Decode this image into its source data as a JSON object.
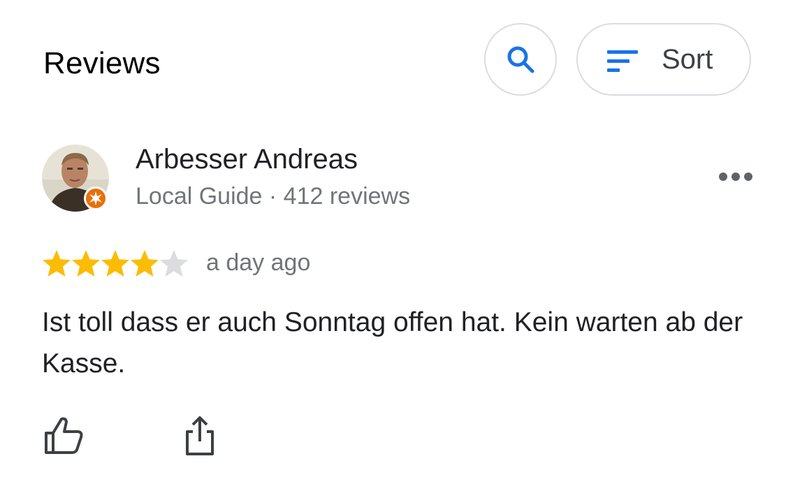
{
  "header": {
    "title": "Reviews",
    "search_icon": "search-icon",
    "sort_icon": "sort-lines-icon",
    "sort_label": "Sort"
  },
  "review": {
    "author": {
      "name": "Arbesser Andreas",
      "meta": "Local Guide · 412 reviews",
      "badge": "local-guide-badge-icon"
    },
    "rating": 4,
    "max_rating": 5,
    "date": "a day ago",
    "text": "Ist toll dass er auch Sonntag offen hat. Kein warten ab der Kasse.",
    "more_icon": "more-horizontal-icon",
    "like_icon": "thumbs-up-icon",
    "share_icon": "share-icon"
  },
  "colors": {
    "accent": "#1a73e8",
    "star_filled": "#fbbc04",
    "star_empty": "#dadce0",
    "badge": "#e8710a",
    "secondary_text": "#70757a",
    "border": "#dadce0"
  }
}
